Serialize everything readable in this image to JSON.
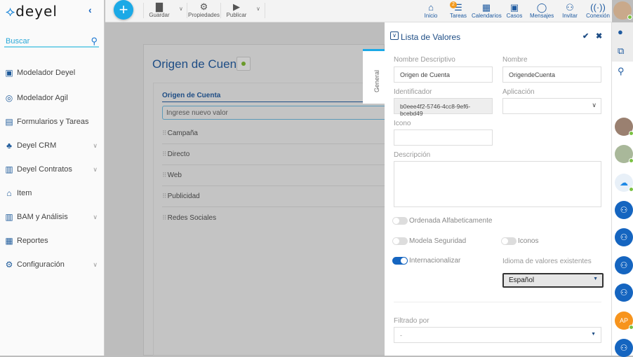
{
  "sidebar": {
    "logo": "deyel",
    "search_placeholder": "Buscar",
    "items": [
      {
        "label": "Modelador Deyel",
        "icon": "gift-icon"
      },
      {
        "label": "Modelador Agil",
        "icon": "agile-icon"
      },
      {
        "label": "Formularios y Tareas",
        "icon": "form-icon"
      },
      {
        "label": "Deyel CRM",
        "icon": "crm-icon"
      },
      {
        "label": "Deyel Contratos",
        "icon": "contract-icon"
      },
      {
        "label": "Item",
        "icon": "bank-icon"
      },
      {
        "label": "BAM y Análisis",
        "icon": "chart-icon"
      },
      {
        "label": "Reportes",
        "icon": "report-icon"
      },
      {
        "label": "Configuración",
        "icon": "gear-icon"
      }
    ]
  },
  "toolbar": {
    "save": "Guardar",
    "properties": "Propiedades",
    "publish": "Publicar"
  },
  "topnav": {
    "items": [
      "Inicio",
      "Tareas",
      "Calendarios",
      "Casos",
      "Mensajes",
      "Invitar",
      "Conexión"
    ],
    "tasks_badge": "2"
  },
  "main": {
    "title": "Origen de Cuenta",
    "section": "Origen de Cuenta",
    "new_value_placeholder": "Ingrese nuevo valor",
    "values": [
      "Campaña",
      "Directo",
      "Web",
      "Publicidad",
      "Redes Sociales"
    ],
    "tab": "General"
  },
  "panel": {
    "title": "Lista de Valores",
    "nombre_descriptivo_label": "Nombre Descriptivo",
    "nombre_descriptivo": "Origen de Cuenta",
    "nombre_label": "Nombre",
    "nombre": "OrigendeCuenta",
    "identificador_label": "Identificador",
    "identificador": "b0eee4f2-5746-4cc8-9ef6-bcebd49",
    "aplicacion_label": "Aplicación",
    "aplicacion": "",
    "icono_label": "Icono",
    "icono": "",
    "descripcion_label": "Descripción",
    "descripcion": "",
    "ordenada_label": "Ordenada Alfabeticamente",
    "ordenada": false,
    "seguridad_label": "Modela Seguridad",
    "seguridad": false,
    "iconos_label": "Iconos",
    "iconos": false,
    "internacionalizar_label": "Internacionalizar",
    "internacionalizar": true,
    "idioma_label": "Idioma de valores existentes",
    "idioma": "Español",
    "filtrado_label": "Filtrado por",
    "filtrado": "-"
  },
  "rail": {
    "user_initials": "AP"
  },
  "colors": {
    "accent": "#1ba9e6",
    "brand": "#1e4d85",
    "toggle_on": "#1565c0",
    "badge": "#f39a1e"
  }
}
